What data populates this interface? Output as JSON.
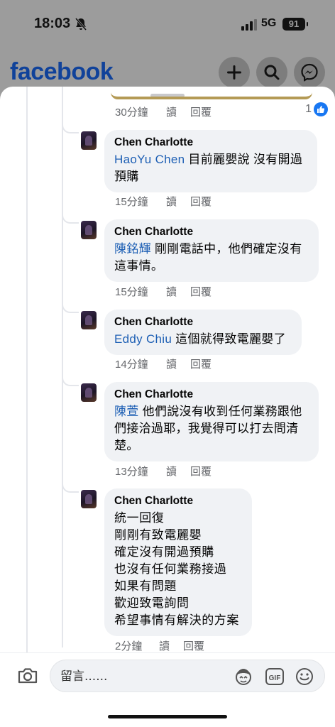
{
  "status_bar": {
    "time": "18:03",
    "network": "5G",
    "battery": "91"
  },
  "header": {
    "logo": "facebook"
  },
  "top_comment_meta": {
    "time": "30分鐘",
    "read": "讀",
    "reply": "回覆",
    "like_count": "1"
  },
  "comments": [
    {
      "author": "Chen Charlotte",
      "mention": "HaoYu Chen",
      "text_line1": " 目前麗嬰說 沒有開過",
      "text_line2": "預購",
      "time": "15分鐘",
      "read": "讀",
      "reply": "回覆"
    },
    {
      "author": "Chen Charlotte",
      "mention": "陳銘輝",
      "text_line1": " 剛剛電話中，他們確定沒有",
      "text_line2": "這事情。",
      "time": "15分鐘",
      "read": "讀",
      "reply": "回覆"
    },
    {
      "author": "Chen Charlotte",
      "mention": "Eddy Chiu",
      "text_line1": " 這個就得致電麗嬰了",
      "time": "14分鐘",
      "read": "讀",
      "reply": "回覆"
    },
    {
      "author": "Chen Charlotte",
      "mention": "陳萱",
      "text_line1": " 他們說沒有收到任何業務跟他",
      "text_line2": "們接洽過耶，我覺得可以打去問清",
      "text_line3": "楚。",
      "time": "13分鐘",
      "read": "讀",
      "reply": "回覆"
    },
    {
      "author": "Chen Charlotte",
      "lines": [
        "統一回復",
        "剛剛有致電麗嬰",
        "確定沒有開過預購",
        "也沒有任何業務接過",
        "如果有問題",
        "歡迎致電詢問",
        "希望事情有解決的方案"
      ],
      "time": "2分鐘",
      "read": "讀",
      "reply": "回覆"
    }
  ],
  "composer": {
    "placeholder": "留言......"
  },
  "colors": {
    "facebook_blue": "#1877f2",
    "mention_blue": "#1d5fb4",
    "bubble_bg": "#f0f2f5"
  },
  "icons": [
    "bell-slash-icon",
    "plus-icon",
    "search-icon",
    "messenger-icon",
    "like-icon",
    "camera-icon",
    "avatar-sticker-icon",
    "gif-icon",
    "emoji-icon"
  ]
}
